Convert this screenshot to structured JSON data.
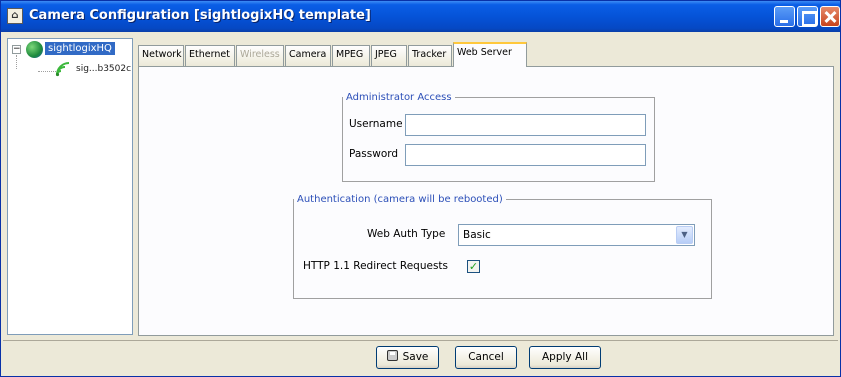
{
  "window": {
    "title": "Camera Configuration [sightlogixHQ template]"
  },
  "tree": {
    "root_label": "sightlogixHQ",
    "child_label": "sig...b3502c"
  },
  "tabs": [
    {
      "label": "Network",
      "state": "normal"
    },
    {
      "label": "Ethernet",
      "state": "normal"
    },
    {
      "label": "Wireless",
      "state": "disabled"
    },
    {
      "label": "Camera",
      "state": "normal"
    },
    {
      "label": "MPEG",
      "state": "normal"
    },
    {
      "label": "JPEG",
      "state": "normal"
    },
    {
      "label": "Tracker",
      "state": "normal"
    },
    {
      "label": "Web Server",
      "state": "active"
    }
  ],
  "admin_access": {
    "legend": "Administrator Access",
    "username_label": "Username",
    "username_value": "",
    "password_label": "Password",
    "password_value": ""
  },
  "authentication": {
    "legend": "Authentication (camera will be rebooted)",
    "web_auth_type_label": "Web Auth Type",
    "web_auth_type_value": "Basic",
    "http_redirect_label": "HTTP 1.1 Redirect Requests",
    "http_redirect_checked": true,
    "check_mark": "✓",
    "dropdown_arrow": "▼"
  },
  "buttons": {
    "save": "Save",
    "cancel": "Cancel",
    "apply_all": "Apply All"
  },
  "icons": {
    "app": "camera-config-icon",
    "tree_root": "globe-icon",
    "tree_child": "wireless-camera-icon",
    "save": "floppy-disk-icon",
    "minimize": "minimize-icon",
    "maximize": "maximize-icon",
    "close": "close-icon"
  },
  "colors": {
    "titlebar": "#0553d8",
    "selection": "#316ac5",
    "legend_text": "#2c4fb8",
    "active_tab_accent": "#ffc83c"
  }
}
